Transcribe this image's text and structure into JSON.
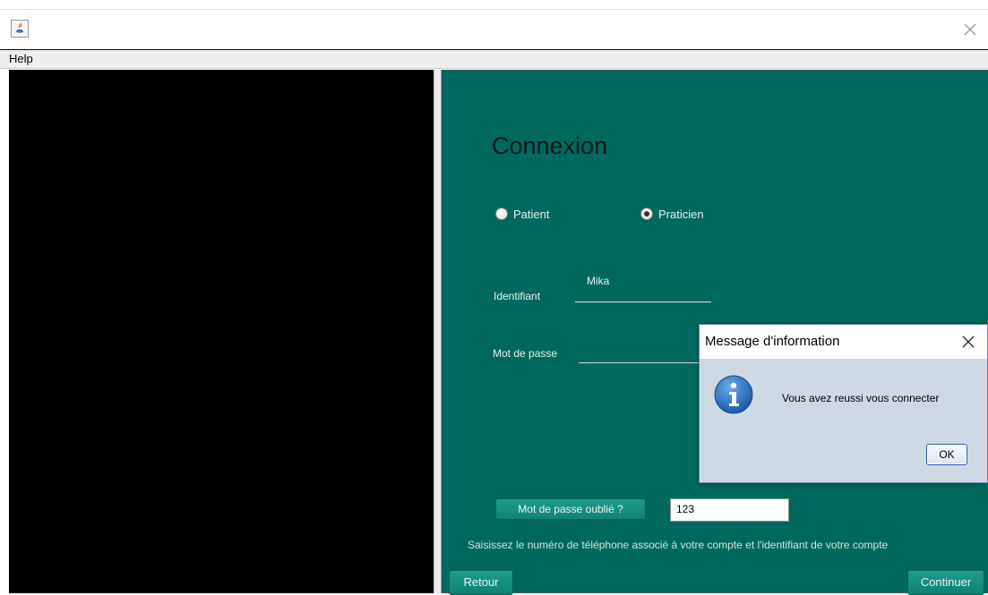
{
  "menu": {
    "help": "Help"
  },
  "login": {
    "title": "Connexion",
    "radio_patient": "Patient",
    "radio_praticien": "Praticien",
    "id_label": "Identifiant",
    "id_value": "Mika",
    "password_label": "Mot de passe",
    "forgot_button": "Mot de passe oublié ?",
    "phone_value": "123",
    "hint": "Saisissez le numéro de téléphone associé à votre compte et l'identifiant de votre compte",
    "back_button": "Retour",
    "continue_button": "Continuer"
  },
  "dialog": {
    "title": "Message d'information",
    "message": "Vous avez reussi vous connecter",
    "ok": "OK"
  },
  "colors": {
    "panel": "#00695c",
    "button": "#0f8274",
    "info_icon": "#2b6fbd"
  }
}
